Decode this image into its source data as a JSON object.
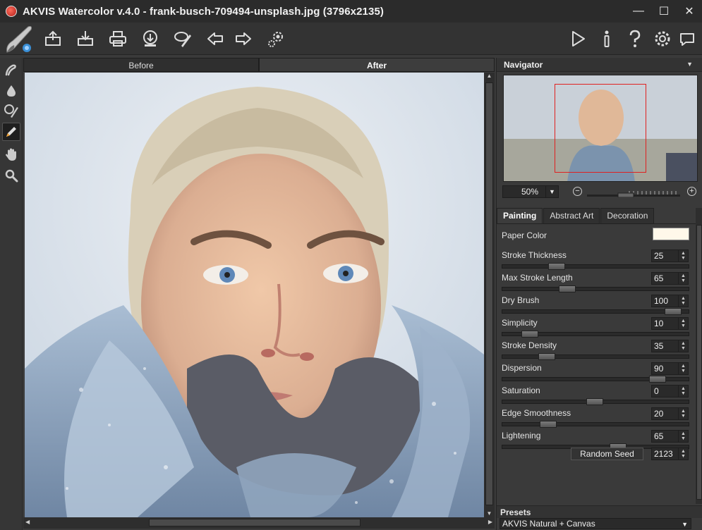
{
  "window": {
    "title": "AKVIS Watercolor v.4.0 - frank-busch-709494-unsplash.jpg (3796x2135)",
    "controls": {
      "minimize": "—",
      "maximize": "☐",
      "close": "✕"
    }
  },
  "toolbar": {
    "left_icons": [
      "open-icon",
      "save-icon",
      "print-icon",
      "share-icon",
      "batch-icon",
      "undo-arrow-icon",
      "redo-arrow-icon",
      "preferences-gear-icon"
    ],
    "right_icons": [
      "run-play-icon",
      "info-icon",
      "help-icon",
      "settings-gear-icon",
      "chat-icon"
    ]
  },
  "view_tabs": {
    "before": "Before",
    "after": "After",
    "active": "after"
  },
  "navigator": {
    "title": "Navigator",
    "zoom": "50%"
  },
  "settings_tabs": [
    {
      "label": "Painting",
      "active": true
    },
    {
      "label": "Abstract Art",
      "active": false
    },
    {
      "label": "Decoration",
      "active": false
    }
  ],
  "params": {
    "paper_color": {
      "label": "Paper Color",
      "color": "#fff8ea"
    },
    "items": [
      {
        "label": "Stroke Thickness",
        "value": "25",
        "slider": 0.27
      },
      {
        "label": "Max Stroke Length",
        "value": "65",
        "slider": 0.33
      },
      {
        "label": "Dry Brush",
        "value": "100",
        "slider": 0.95
      },
      {
        "label": "Simplicity",
        "value": "10",
        "slider": 0.11
      },
      {
        "label": "Stroke Density",
        "value": "35",
        "slider": 0.21
      },
      {
        "label": "Dispersion",
        "value": "90",
        "slider": 0.86
      },
      {
        "label": "Saturation",
        "value": "0",
        "slider": 0.49
      },
      {
        "label": "Edge Smoothness",
        "value": "20",
        "slider": 0.22
      },
      {
        "label": "Lightening",
        "value": "65",
        "slider": 0.63
      }
    ],
    "random_seed": {
      "label": "Random Seed",
      "value": "2123"
    }
  },
  "presets": {
    "title": "Presets",
    "selected": "AKVIS Natural + Canvas"
  }
}
